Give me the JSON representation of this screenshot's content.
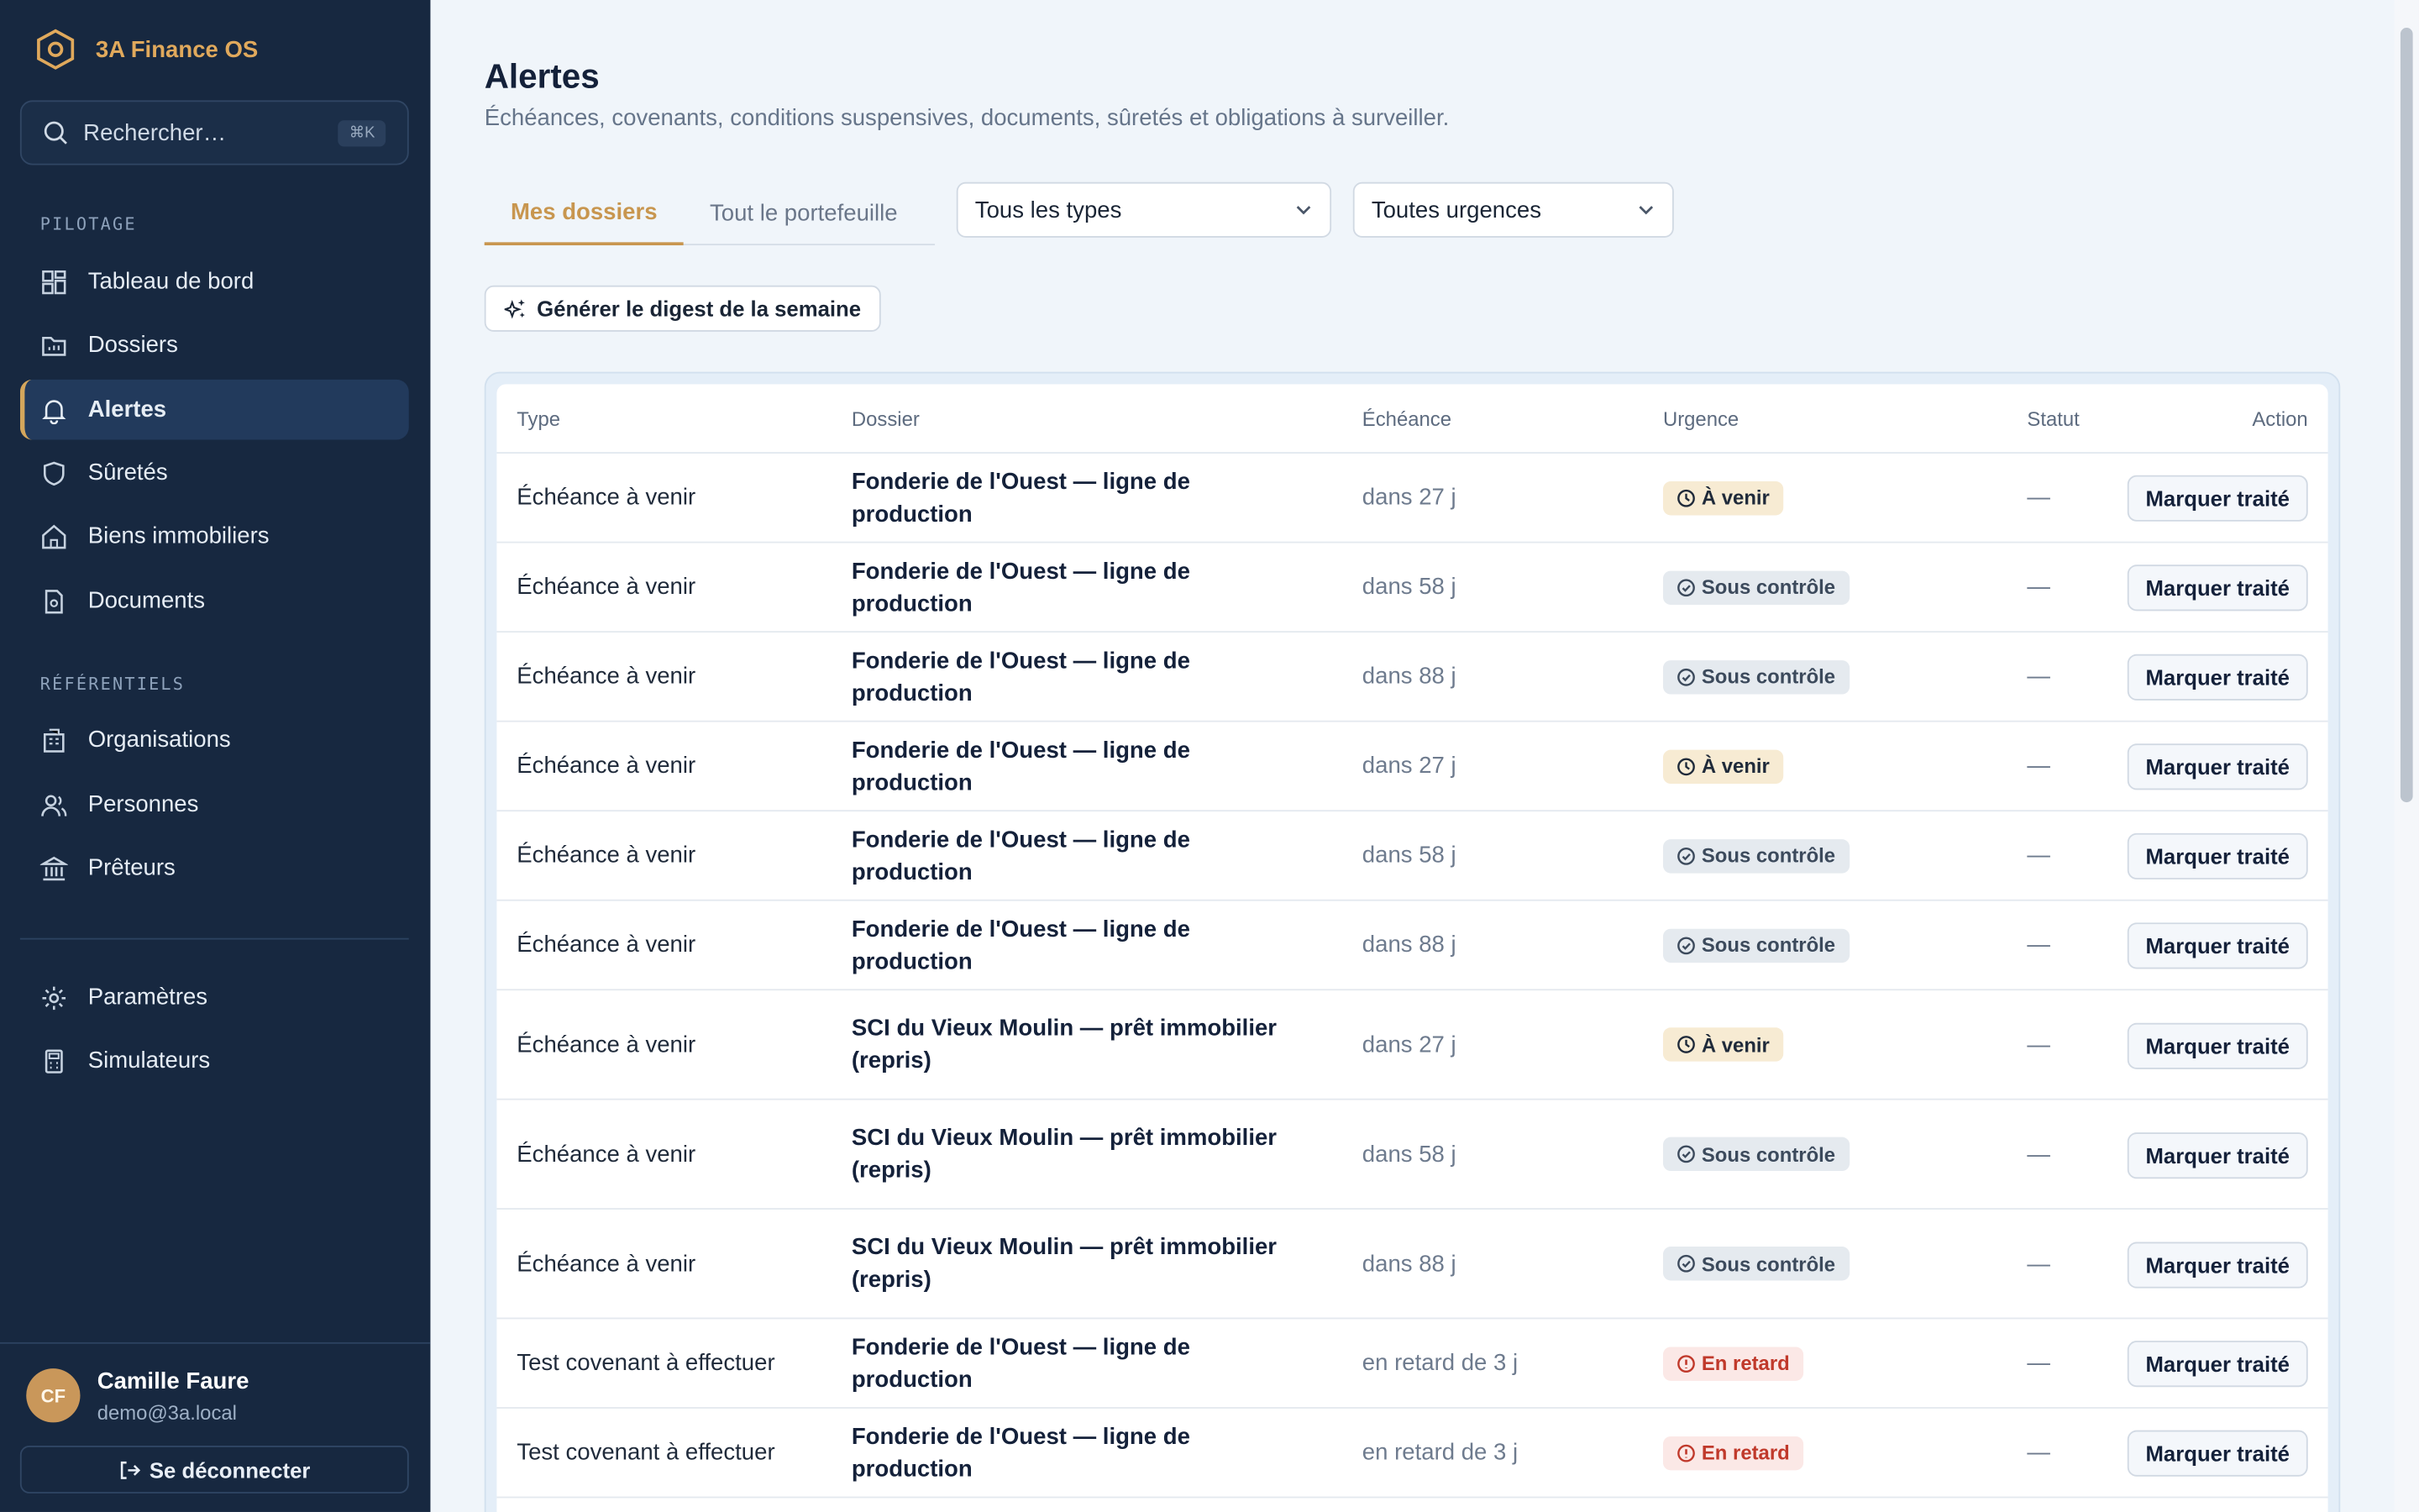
{
  "app": {
    "name": "3A Finance OS"
  },
  "search": {
    "placeholder": "Rechercher…",
    "shortcut": "⌘K"
  },
  "sidebar": {
    "sections": [
      {
        "label": "PILOTAGE",
        "items": [
          {
            "label": "Tableau de bord",
            "icon": "dashboard-icon"
          },
          {
            "label": "Dossiers",
            "icon": "folder-icon"
          },
          {
            "label": "Alertes",
            "icon": "bell-icon",
            "active": true
          },
          {
            "label": "Sûretés",
            "icon": "shield-icon"
          },
          {
            "label": "Biens immobiliers",
            "icon": "home-icon"
          },
          {
            "label": "Documents",
            "icon": "document-icon"
          }
        ]
      },
      {
        "label": "RÉFÉRENTIELS",
        "items": [
          {
            "label": "Organisations",
            "icon": "building-icon"
          },
          {
            "label": "Personnes",
            "icon": "users-icon"
          },
          {
            "label": "Prêteurs",
            "icon": "bank-icon"
          }
        ]
      }
    ],
    "bottom": [
      {
        "label": "Paramètres",
        "icon": "gear-icon"
      },
      {
        "label": "Simulateurs",
        "icon": "calculator-icon"
      }
    ]
  },
  "user": {
    "initials": "CF",
    "name": "Camille Faure",
    "email": "demo@3a.local",
    "logout": "Se déconnecter"
  },
  "page": {
    "title": "Alertes",
    "subtitle": "Échéances, covenants, conditions suspensives, documents, sûretés et obligations à surveiller."
  },
  "tabs": [
    {
      "label": "Mes dossiers",
      "active": true
    },
    {
      "label": "Tout le portefeuille",
      "active": false
    }
  ],
  "filters": {
    "type": "Tous les types",
    "urgency": "Toutes urgences"
  },
  "digest_label": "Générer le digest de la semaine",
  "table": {
    "headers": {
      "type": "Type",
      "dossier": "Dossier",
      "echeance": "Échéance",
      "urgence": "Urgence",
      "statut": "Statut",
      "action": "Action"
    },
    "action_label": "Marquer traité",
    "rows": [
      {
        "type": "Échéance à venir",
        "dossier": "Fonderie de l'Ouest — ligne de production",
        "echeance": "dans 27 j",
        "urgence": "À venir",
        "level": "venir",
        "statut": "—"
      },
      {
        "type": "Échéance à venir",
        "dossier": "Fonderie de l'Ouest — ligne de production",
        "echeance": "dans 58 j",
        "urgence": "Sous contrôle",
        "level": "ctrl",
        "statut": "—"
      },
      {
        "type": "Échéance à venir",
        "dossier": "Fonderie de l'Ouest — ligne de production",
        "echeance": "dans 88 j",
        "urgence": "Sous contrôle",
        "level": "ctrl",
        "statut": "—"
      },
      {
        "type": "Échéance à venir",
        "dossier": "Fonderie de l'Ouest — ligne de production",
        "echeance": "dans 27 j",
        "urgence": "À venir",
        "level": "venir",
        "statut": "—"
      },
      {
        "type": "Échéance à venir",
        "dossier": "Fonderie de l'Ouest — ligne de production",
        "echeance": "dans 58 j",
        "urgence": "Sous contrôle",
        "level": "ctrl",
        "statut": "—"
      },
      {
        "type": "Échéance à venir",
        "dossier": "Fonderie de l'Ouest — ligne de production",
        "echeance": "dans 88 j",
        "urgence": "Sous contrôle",
        "level": "ctrl",
        "statut": "—"
      },
      {
        "type": "Échéance à venir",
        "dossier": "SCI du Vieux Moulin — prêt immobilier (repris)",
        "echeance": "dans 27 j",
        "urgence": "À venir",
        "level": "venir",
        "statut": "—"
      },
      {
        "type": "Échéance à venir",
        "dossier": "SCI du Vieux Moulin — prêt immobilier (repris)",
        "echeance": "dans 58 j",
        "urgence": "Sous contrôle",
        "level": "ctrl",
        "statut": "—"
      },
      {
        "type": "Échéance à venir",
        "dossier": "SCI du Vieux Moulin — prêt immobilier (repris)",
        "echeance": "dans 88 j",
        "urgence": "Sous contrôle",
        "level": "ctrl",
        "statut": "—"
      },
      {
        "type": "Test covenant à effectuer",
        "dossier": "Fonderie de l'Ouest — ligne de production",
        "echeance": "en retard de 3 j",
        "urgence": "En retard",
        "level": "retard",
        "statut": "—"
      },
      {
        "type": "Test covenant à effectuer",
        "dossier": "Fonderie de l'Ouest — ligne de production",
        "echeance": "en retard de 3 j",
        "urgence": "En retard",
        "level": "retard",
        "statut": "—"
      }
    ]
  }
}
